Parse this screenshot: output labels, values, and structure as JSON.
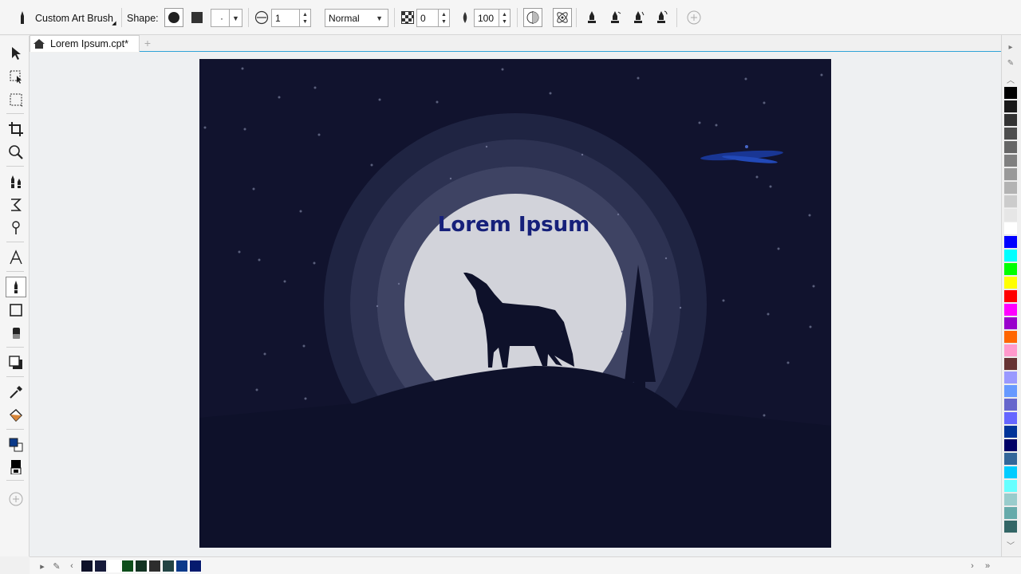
{
  "propbar": {
    "brush_name": "Custom Art Brush",
    "shape_label": "Shape:",
    "nib_size_value": "1",
    "blend_mode": "Normal",
    "transparency_value": "0",
    "flow_value": "100",
    "size_preview_dot": "·"
  },
  "document": {
    "tab_title": "Lorem Ipsum.cpt*"
  },
  "artwork": {
    "headline": "Lorem Ipsum",
    "sky_color": "#11132e",
    "moon_color": "#d2d3da",
    "halo_colors": [
      "#1f2442",
      "#2d3252",
      "#3e4363",
      "#555a78"
    ],
    "silhouette_color": "#0e112a",
    "headline_color": "#16207a"
  },
  "palette": {
    "swatches": [
      "#000000",
      "#1a1a1a",
      "#333333",
      "#4d4d4d",
      "#666666",
      "#808080",
      "#999999",
      "#b3b3b3",
      "#cccccc",
      "#e6e6e6",
      "#ffffff",
      "#0000ff",
      "#00ffff",
      "#00ff00",
      "#ffff00",
      "#ff0000",
      "#ff00ff",
      "#9900cc",
      "#ff6600",
      "#ff99cc",
      "#663333",
      "#9999ff",
      "#6699ff",
      "#6666cc",
      "#6666ff",
      "#003399",
      "#000066",
      "#336699",
      "#00ccff",
      "#66ffff",
      "#99cccc",
      "#66aaaa",
      "#336666"
    ]
  },
  "document_palette": {
    "swatches": [
      "#0e1129",
      "#161a3a",
      "#ffffff",
      "#0d4d1a",
      "#123322",
      "#2d2d2d",
      "#224444",
      "#0b3a8a",
      "#061a6e"
    ]
  },
  "colors": {
    "fill": "#0b3a8a",
    "outline": "#ffffff",
    "accent_line": "#2ea3d8"
  }
}
